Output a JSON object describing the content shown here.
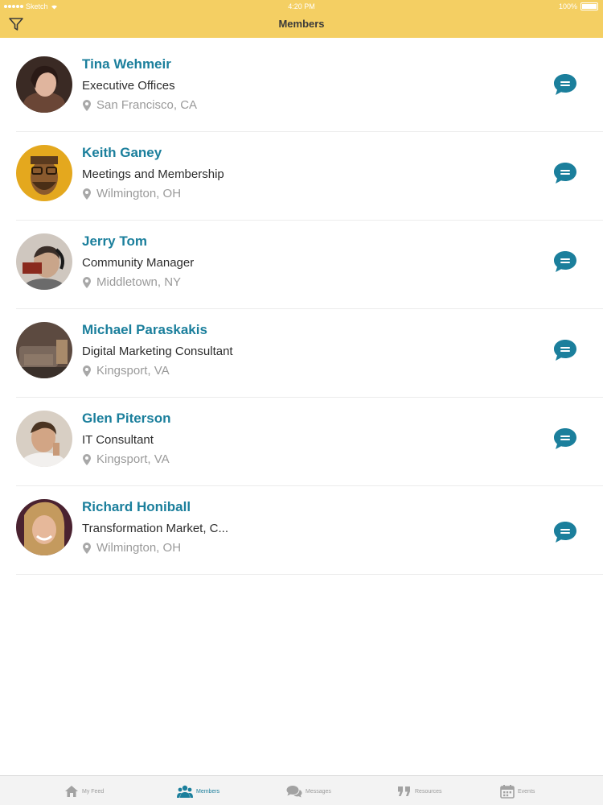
{
  "status_bar": {
    "carrier": "Sketch",
    "time": "4:20 PM",
    "battery": "100%"
  },
  "header": {
    "title": "Members"
  },
  "members": [
    {
      "name": "Tina Wehmeir",
      "role": "Executive Offices",
      "location": "San Francisco, CA"
    },
    {
      "name": "Keith Ganey",
      "role": "Meetings and Membership",
      "location": "Wilmington, OH"
    },
    {
      "name": "Jerry Tom",
      "role": "Community Manager",
      "location": "Middletown, NY"
    },
    {
      "name": "Michael Paraskakis",
      "role": "Digital Marketing Consultant",
      "location": "Kingsport, VA"
    },
    {
      "name": "Glen Piterson",
      "role": "IT Consultant",
      "location": "Kingsport, VA"
    },
    {
      "name": "Richard Honiball",
      "role": "Transformation Market, C...",
      "location": "Wilmington, OH"
    }
  ],
  "tabs": [
    {
      "label": "My Feed",
      "icon": "home-icon",
      "active": false
    },
    {
      "label": "Members",
      "icon": "members-icon",
      "active": true
    },
    {
      "label": "Messages",
      "icon": "messages-icon",
      "active": false
    },
    {
      "label": "Resources",
      "icon": "quote-icon",
      "active": false
    },
    {
      "label": "Events",
      "icon": "calendar-icon",
      "active": false
    }
  ],
  "colors": {
    "header_bg": "#f4cf63",
    "accent": "#1b7f9c",
    "name_text": "#1b7f9c",
    "location_text": "#9a9a9a"
  }
}
